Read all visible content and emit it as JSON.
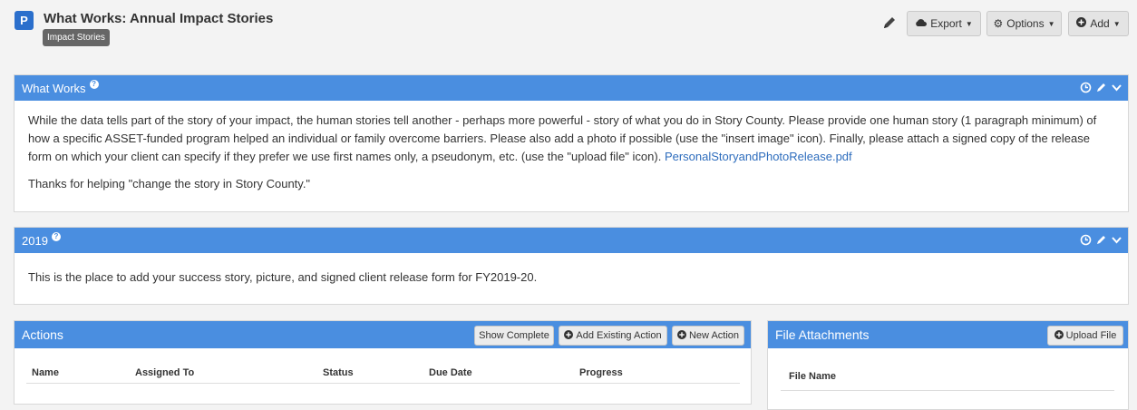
{
  "header": {
    "badge": "P",
    "title": "What Works: Annual Impact Stories",
    "tag": "Impact Stories",
    "buttons": {
      "export": "Export",
      "options": "Options",
      "add": "Add"
    }
  },
  "panels": [
    {
      "title": "What Works",
      "paragraphs": [
        "While the data tells part of the story of your impact, the human stories tell another - perhaps more powerful - story of what you do in Story County. Please provide one human story (1 paragraph minimum) of how a specific ASSET-funded program helped an individual or family overcome barriers. Please also add a photo if possible (use the \"insert image\" icon). Finally, please attach a signed copy of the release form on which your client can specify if they prefer we use first names only, a pseudonym, etc. (use the \"upload file\" icon).",
        "Thanks for helping \"change the story in Story County.\""
      ],
      "link": "PersonalStoryandPhotoRelease.pdf"
    },
    {
      "title": "2019",
      "paragraphs": [
        "This is the place to add your success story, picture, and signed client release form for FY2019-20."
      ]
    }
  ],
  "actions": {
    "title": "Actions",
    "buttons": {
      "show_complete": "Show Complete",
      "add_existing": "Add Existing Action",
      "new_action": "New Action"
    },
    "columns": [
      "Name",
      "Assigned To",
      "Status",
      "Due Date",
      "Progress"
    ]
  },
  "files": {
    "title": "File Attachments",
    "upload": "Upload File",
    "columns": [
      "File Name"
    ]
  },
  "colors": {
    "accent": "#4a8ee0",
    "badge": "#2b6fcc",
    "link": "#2e6dbd"
  }
}
